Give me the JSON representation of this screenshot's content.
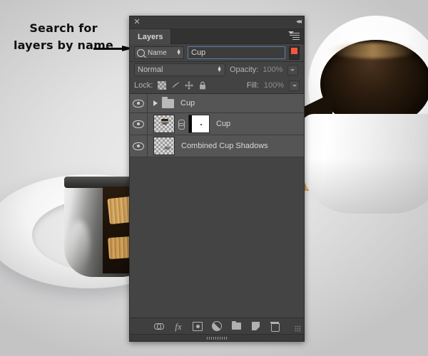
{
  "annotation": {
    "text": "Search for layers by name",
    "arrow": "arrow-right"
  },
  "panel": {
    "close_label": "✕",
    "collapse_label": "◂◂",
    "tabs": [
      {
        "label": "Layers",
        "active": true
      }
    ],
    "menu_icon": "panel-menu-icon"
  },
  "filter": {
    "type_label": "Name",
    "type_icon": "search-icon",
    "stepper_icon": "up-down-arrows-icon",
    "query_value": "Cup",
    "query_placeholder": "",
    "toggle_color": "#f4573f",
    "toggle_state": "on"
  },
  "blend": {
    "mode": "Normal",
    "opacity_label": "Opacity:",
    "opacity_value": "100%"
  },
  "lock": {
    "label": "Lock:",
    "icons": [
      "transparency-checker-icon",
      "brush-icon",
      "move-arrows-icon",
      "padlock-icon"
    ],
    "fill_label": "Fill:",
    "fill_value": "100%"
  },
  "layers": [
    {
      "name": "Cup",
      "kind": "group",
      "visible": true,
      "expanded": false
    },
    {
      "name": "Cup",
      "kind": "layer-with-mask",
      "visible": true,
      "linked": true
    },
    {
      "name": "Combined Cup Shadows",
      "kind": "layer",
      "visible": true
    }
  ],
  "bottom_toolbar": {
    "buttons": [
      "link-layers-icon",
      "layer-style-fx-icon",
      "add-layer-mask-icon",
      "new-adjustment-layer-icon",
      "new-group-icon",
      "new-layer-icon",
      "delete-layer-icon"
    ],
    "fx_label": "fx"
  },
  "colors": {
    "panel_bg": "#393939",
    "list_bg": "#444444",
    "row_bg": "#555555",
    "accent_red": "#f4573f",
    "field_outline": "#5a7fa8"
  }
}
